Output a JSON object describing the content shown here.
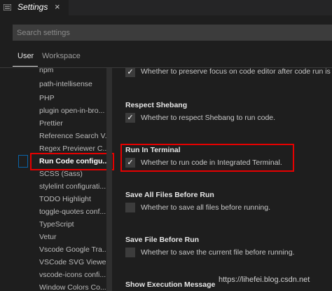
{
  "tab": {
    "title": "Settings",
    "close": "×",
    "icon": "file-icon"
  },
  "search": {
    "placeholder": "Search settings"
  },
  "scopes": {
    "user": "User",
    "workspace": "Workspace"
  },
  "toc": [
    "npm",
    "path-intellisense",
    "PHP",
    "plugin open-in-bro...",
    "Prettier",
    "Reference Search V...",
    "Regex Previewer C...",
    "Run Code configu...",
    "SCSS (Sass)",
    "stylelint configurati...",
    "TODO Highlight",
    "toggle-quotes conf...",
    "TypeScript",
    "Vetur",
    "Vscode Google Tra...",
    "VSCode SVG Viewe...",
    "vscode-icons confi...",
    "Window Colors Co..."
  ],
  "toc_selected_index": 7,
  "settings": [
    {
      "title": "",
      "desc": "Whether to preserve focus on code editor after code run is",
      "checked": true
    },
    {
      "title": "Respect Shebang",
      "desc": "Whether to respect Shebang to run code.",
      "checked": true
    },
    {
      "title": "Run In Terminal",
      "desc": "Whether to run code in Integrated Terminal.",
      "checked": true
    },
    {
      "title": "Save All Files Before Run",
      "desc": "Whether to save all files before running.",
      "checked": false
    },
    {
      "title": "Save File Before Run",
      "desc": "Whether to save the current file before running.",
      "checked": false
    },
    {
      "title": "Show Execution Message",
      "desc": "",
      "checked": false
    }
  ],
  "watermark": "https://lihefei.blog.csdn.net",
  "colors": {
    "highlight": "#e60000",
    "selection": "#0a64a8",
    "background": "#1e1e1e"
  }
}
